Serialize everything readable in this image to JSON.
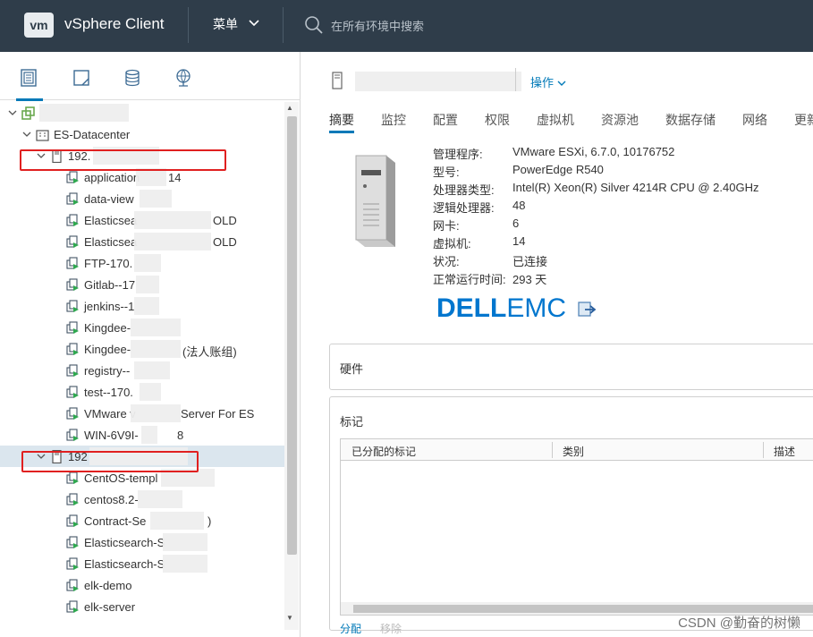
{
  "header": {
    "logo_text": "vm",
    "app_title": "vSphere Client",
    "menu_label": "菜单",
    "search_placeholder": "在所有环境中搜索"
  },
  "navigator": {
    "tabs": [
      {
        "icon": "hosts-and-clusters-icon",
        "active": true
      },
      {
        "icon": "vms-and-templates-icon",
        "active": false
      },
      {
        "icon": "storage-icon",
        "active": false
      },
      {
        "icon": "networking-icon",
        "active": false
      }
    ],
    "tree": [
      {
        "label": "",
        "type": "vcenter",
        "level": 0,
        "expanded": true
      },
      {
        "label": "ES-Datacenter",
        "type": "datacenter",
        "level": 1,
        "expanded": true
      },
      {
        "label": "192.",
        "type": "host",
        "level": 2,
        "expanded": true
      },
      {
        "label": "application",
        "suffix": "14",
        "type": "vm",
        "level": 3
      },
      {
        "label": "data-view",
        "suffix": "",
        "type": "vm",
        "level": 3
      },
      {
        "label": "Elasticsea",
        "suffix": "OLD",
        "type": "vm",
        "level": 3
      },
      {
        "label": "Elasticsea",
        "suffix": "OLD",
        "type": "vm",
        "level": 3
      },
      {
        "label": "FTP-170.",
        "suffix": "",
        "type": "vm",
        "level": 3
      },
      {
        "label": "Gitlab--17",
        "suffix": "",
        "type": "vm",
        "level": 3
      },
      {
        "label": "jenkins--1",
        "suffix": "",
        "type": "vm",
        "level": 3
      },
      {
        "label": "Kingdee-",
        "suffix": "",
        "type": "vm",
        "level": 3
      },
      {
        "label": "Kingdee-",
        "suffix": "(法人账组)",
        "type": "vm",
        "level": 3
      },
      {
        "label": "registry--",
        "suffix": "",
        "type": "vm",
        "level": 3
      },
      {
        "label": "test--170.",
        "suffix": "",
        "type": "vm",
        "level": 3
      },
      {
        "label": "VMware v",
        "suffix": "Server For ES",
        "type": "vm",
        "level": 3
      },
      {
        "label": "WIN-6V9I-",
        "suffix": "8",
        "type": "vm",
        "level": 3
      },
      {
        "label": "192",
        "type": "host",
        "level": 2,
        "expanded": true,
        "selected": true
      },
      {
        "label": "CentOS-templ",
        "suffix": "",
        "type": "vm",
        "level": 3
      },
      {
        "label": "centos8.2-",
        "suffix": "",
        "type": "vm",
        "level": 3
      },
      {
        "label": "Contract-Se",
        "suffix": ")",
        "type": "vm",
        "level": 3
      },
      {
        "label": "Elasticsearch-S",
        "suffix": "",
        "type": "vm",
        "level": 3
      },
      {
        "label": "Elasticsearch-S",
        "suffix": "",
        "type": "vm",
        "level": 3
      },
      {
        "label": "elk-demo",
        "suffix": "",
        "type": "vm",
        "level": 3
      },
      {
        "label": "elk-server",
        "suffix": "",
        "type": "vm",
        "level": 3
      }
    ]
  },
  "content": {
    "actions_label": "操作",
    "tabs": [
      "摘要",
      "监控",
      "配置",
      "权限",
      "虚拟机",
      "资源池",
      "数据存储",
      "网络",
      "更新"
    ],
    "active_tab": "摘要",
    "properties": [
      {
        "key": "管理程序:",
        "value": "VMware ESXi, 6.7.0, 10176752"
      },
      {
        "key": "型号:",
        "value": "PowerEdge R540"
      },
      {
        "key": "处理器类型:",
        "value": "Intel(R) Xeon(R) Silver 4214R CPU @ 2.40GHz"
      },
      {
        "key": "逻辑处理器:",
        "value": "48"
      },
      {
        "key": "网卡:",
        "value": "6"
      },
      {
        "key": "虚拟机:",
        "value": "14"
      },
      {
        "key": "状况:",
        "value": "已连接"
      },
      {
        "key": "正常运行时间:",
        "value": "293 天"
      }
    ],
    "vendor_logo": {
      "d": "D",
      "ell": "ELL",
      "emc": "EMC"
    },
    "hardware_panel_title": "硬件",
    "tags_panel": {
      "title": "标记",
      "columns": [
        "已分配的标记",
        "类别",
        "描述"
      ]
    },
    "bottom_links": [
      "分配",
      "移除"
    ]
  },
  "watermark": "CSDN @勤奋的树懒"
}
